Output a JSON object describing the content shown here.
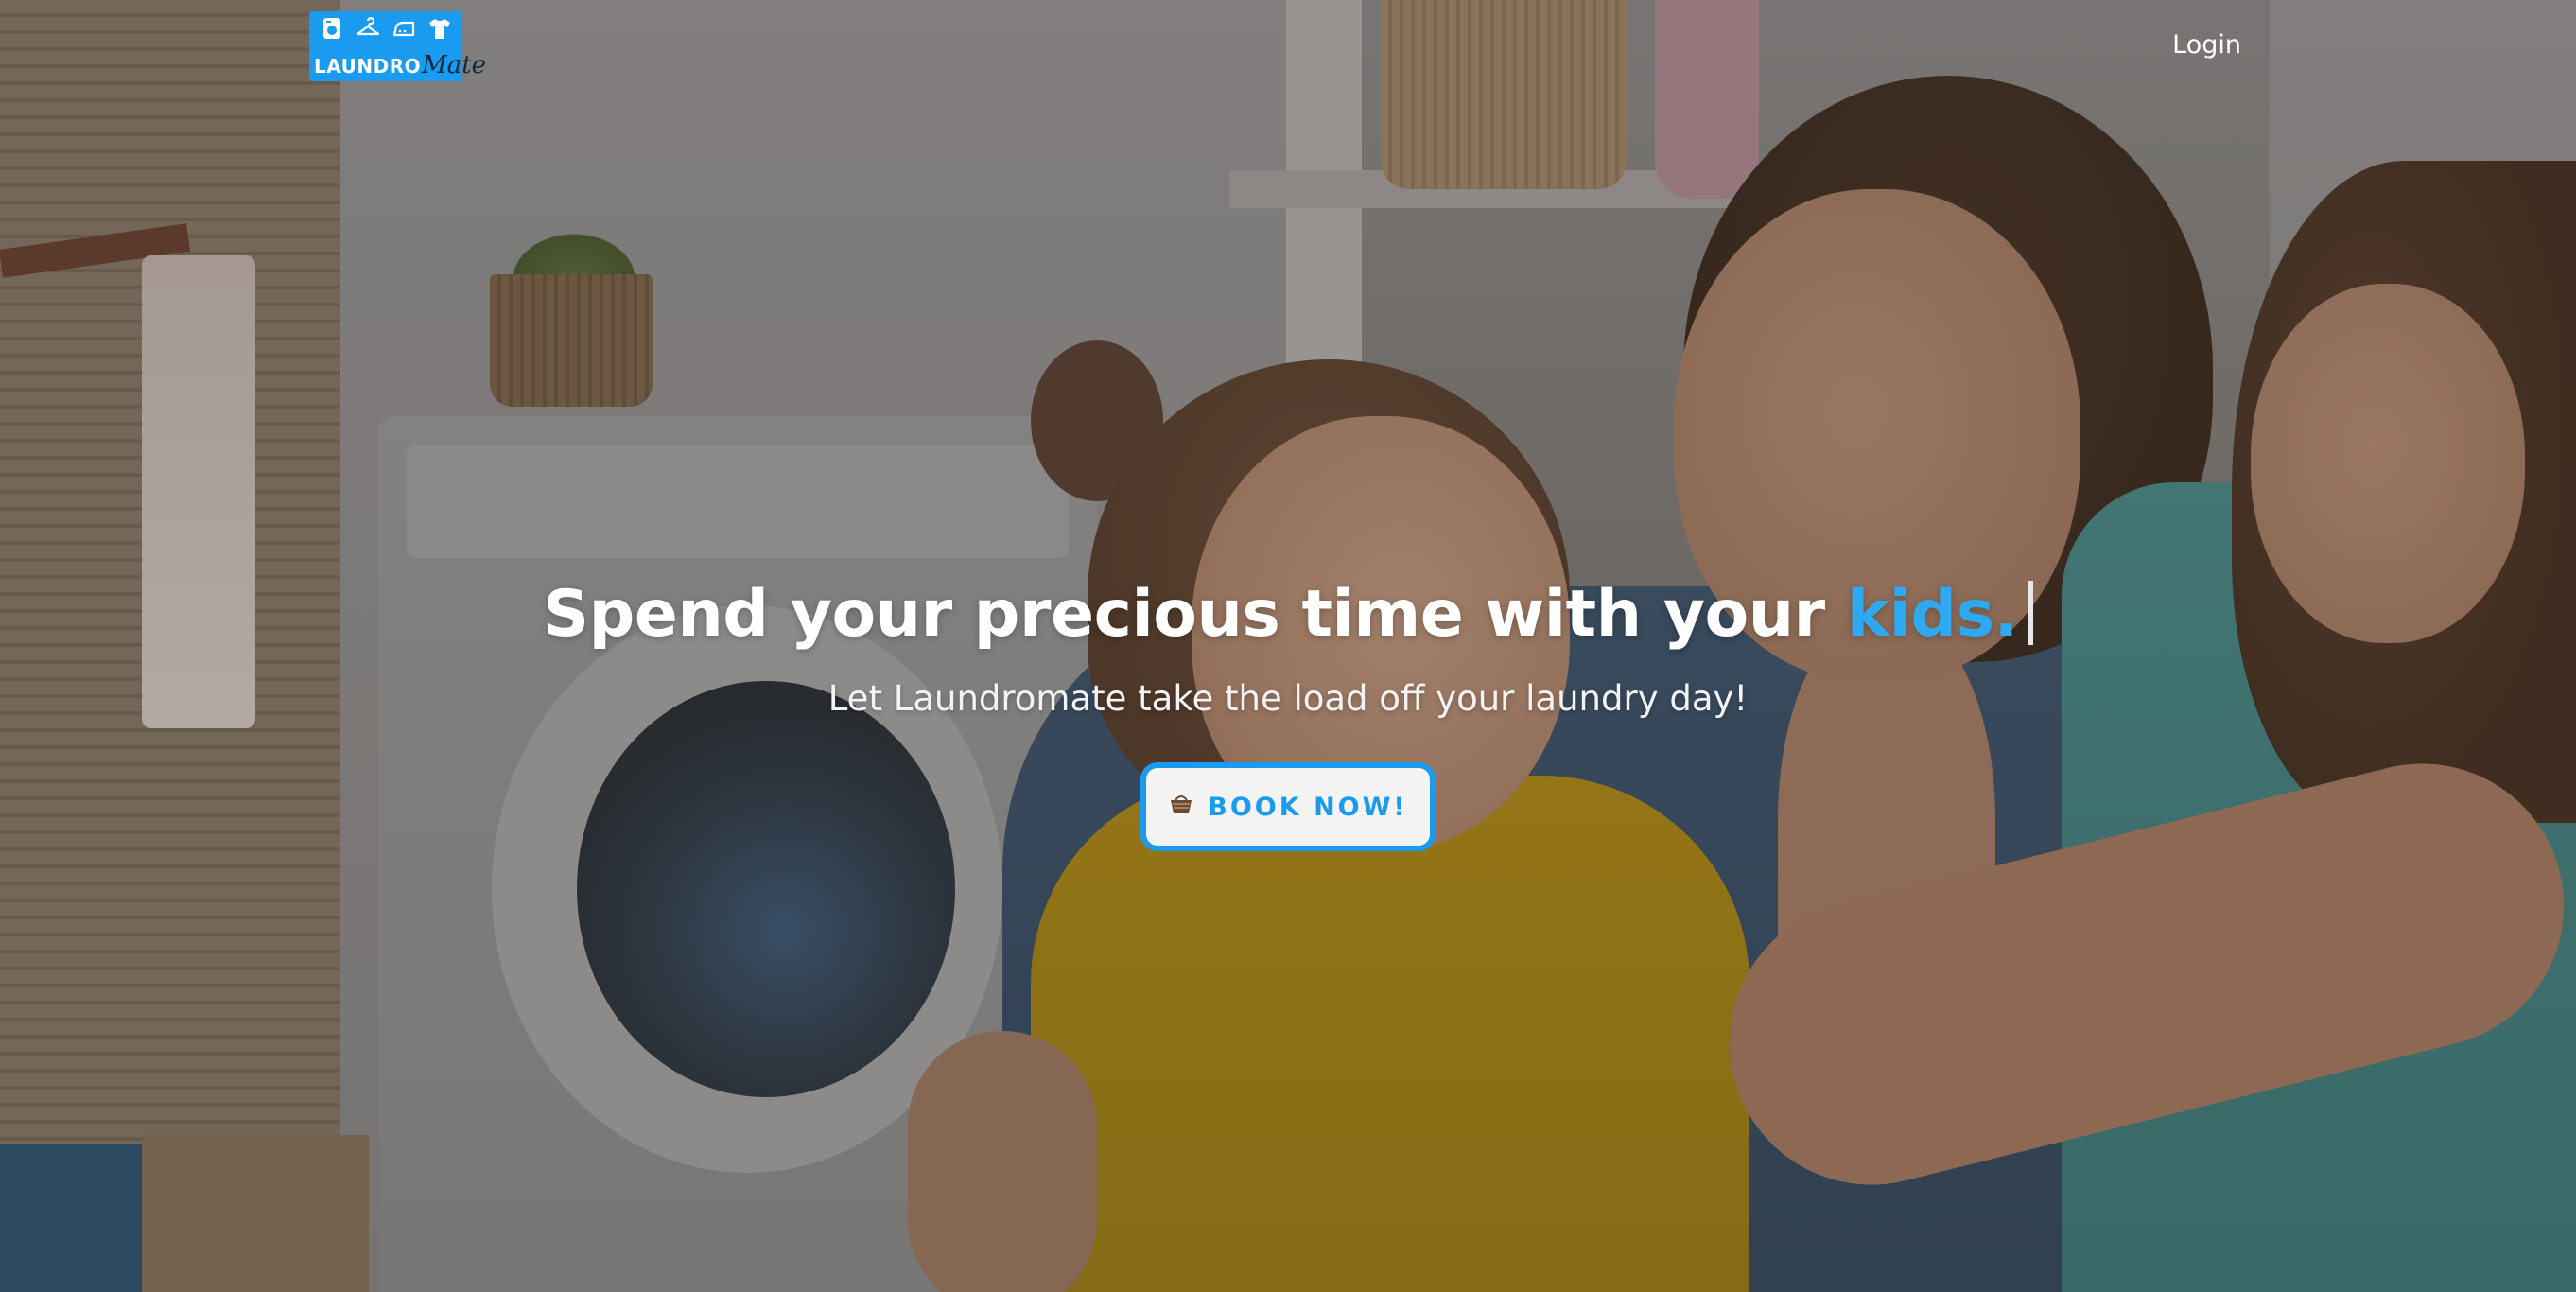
{
  "header": {
    "logo": {
      "word_a": "LAUNDRO",
      "word_b": "Mate",
      "brand_color": "#1a9bef",
      "icons": [
        "washing-machine-icon",
        "hanger-icon",
        "iron-icon",
        "tshirt-icon"
      ]
    },
    "login_label": "Login"
  },
  "hero": {
    "headline_main": "Spend your precious time with your ",
    "headline_accent": "kids.",
    "accent_color": "#2ea8f1",
    "subheadline": "Let Laundromate take the load off your laundry day!",
    "cta": {
      "icon": "laundry-basket-icon",
      "label": "BOOK NOW!"
    }
  }
}
